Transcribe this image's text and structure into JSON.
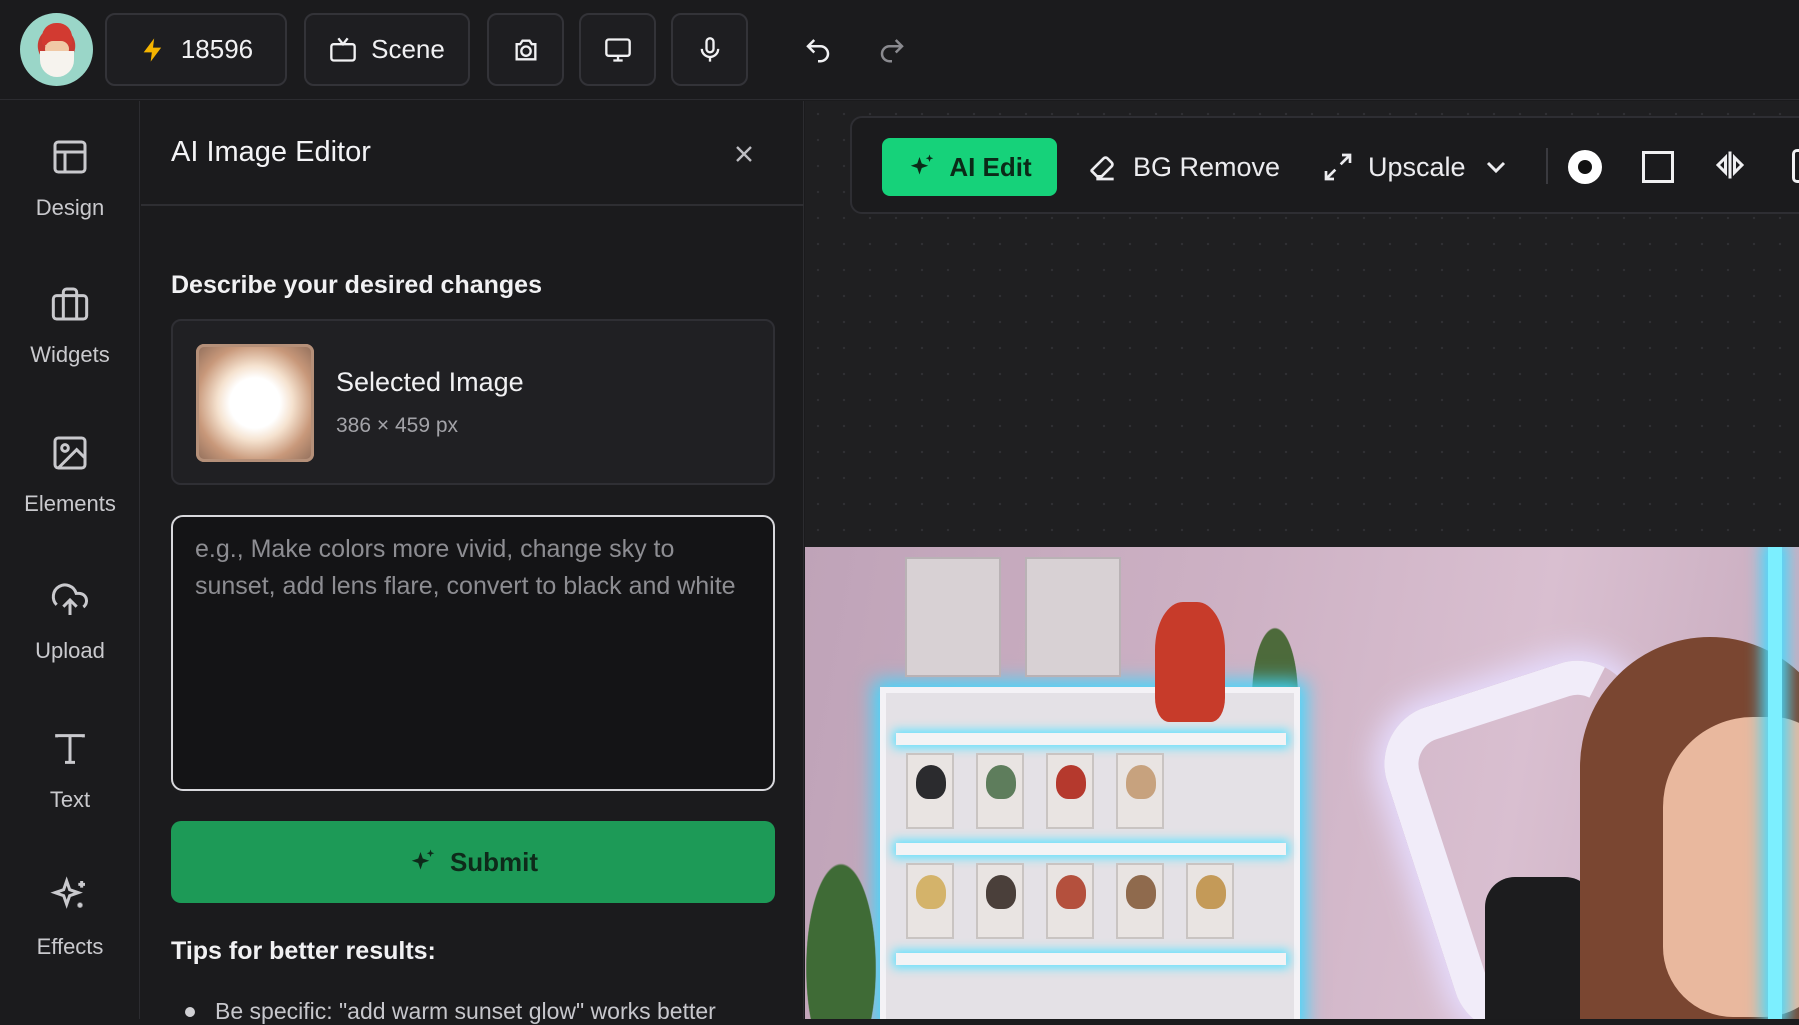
{
  "topbar": {
    "avatar_icon": "santa-avatar-icon",
    "credits": "18596",
    "scene_label": "Scene",
    "icons": [
      "lightning-icon",
      "tv-icon",
      "camera-icon",
      "monitor-icon",
      "microphone-icon",
      "undo-icon",
      "redo-icon"
    ]
  },
  "rail": {
    "items": [
      {
        "label": "Design",
        "icon": "layout-icon"
      },
      {
        "label": "Widgets",
        "icon": "briefcase-icon"
      },
      {
        "label": "Elements",
        "icon": "image-icon"
      },
      {
        "label": "Upload",
        "icon": "cloud-upload-icon"
      },
      {
        "label": "Text",
        "icon": "text-icon"
      },
      {
        "label": "Effects",
        "icon": "sparkles-icon"
      }
    ]
  },
  "panel": {
    "title": "AI Image Editor",
    "section_label": "Describe your desired changes",
    "selected": {
      "title": "Selected Image",
      "dims": "386 × 459 px"
    },
    "prompt": {
      "value": "",
      "placeholder": "e.g., Make colors more vivid, change sky to sunset, add lens flare, convert to black and white"
    },
    "submit_label": "Submit",
    "tips_title": "Tips for better results:",
    "tips": [
      "Be specific: \"add warm sunset glow\" works better"
    ]
  },
  "toolbar": {
    "ai_edit_label": "AI Edit",
    "bg_remove_label": "BG Remove",
    "upscale_label": "Upscale"
  },
  "colors": {
    "accent_green": "#16d27a",
    "submit_green": "#1d9a57",
    "background": "#1b1b1d"
  }
}
